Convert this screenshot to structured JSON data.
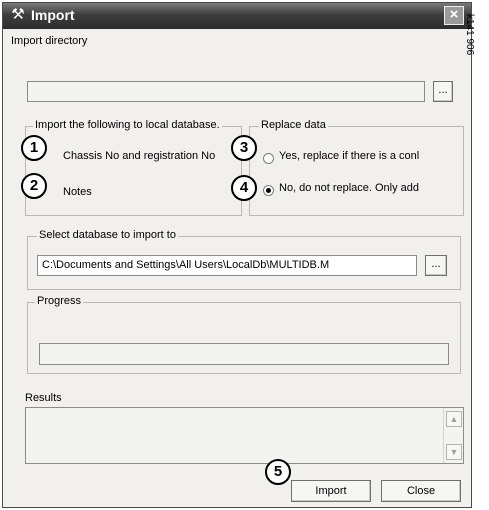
{
  "window": {
    "title": "Import",
    "close_glyph": "×",
    "app_icon": "tools-icon"
  },
  "side_code": "k141 906",
  "import_directory": {
    "label": "Import directory",
    "value": "",
    "browse_label": "..."
  },
  "local_db_group": {
    "legend": "Import the following to local database.",
    "items": [
      {
        "label": "Chassis No and registration No",
        "callout": "1"
      },
      {
        "label": "Notes",
        "callout": "2"
      }
    ]
  },
  "replace_group": {
    "legend": "Replace data",
    "options": [
      {
        "label": "Yes, replace if there is a conl",
        "callout": "3",
        "selected": false
      },
      {
        "label": "No, do not replace. Only add",
        "callout": "4",
        "selected": true
      }
    ]
  },
  "select_db_group": {
    "legend": "Select database to import to",
    "path": "C:\\Documents and Settings\\All Users\\LocalDb\\MULTIDB.M",
    "browse_label": "..."
  },
  "progress_group": {
    "legend": "Progress",
    "value": 0
  },
  "results": {
    "label": "Results",
    "text": ""
  },
  "buttons": {
    "import_label": "Import",
    "import_callout": "5",
    "close_label": "Close"
  },
  "colors": {
    "title_bar": "#3e3e3e",
    "window_bg": "#f1f0ec"
  }
}
